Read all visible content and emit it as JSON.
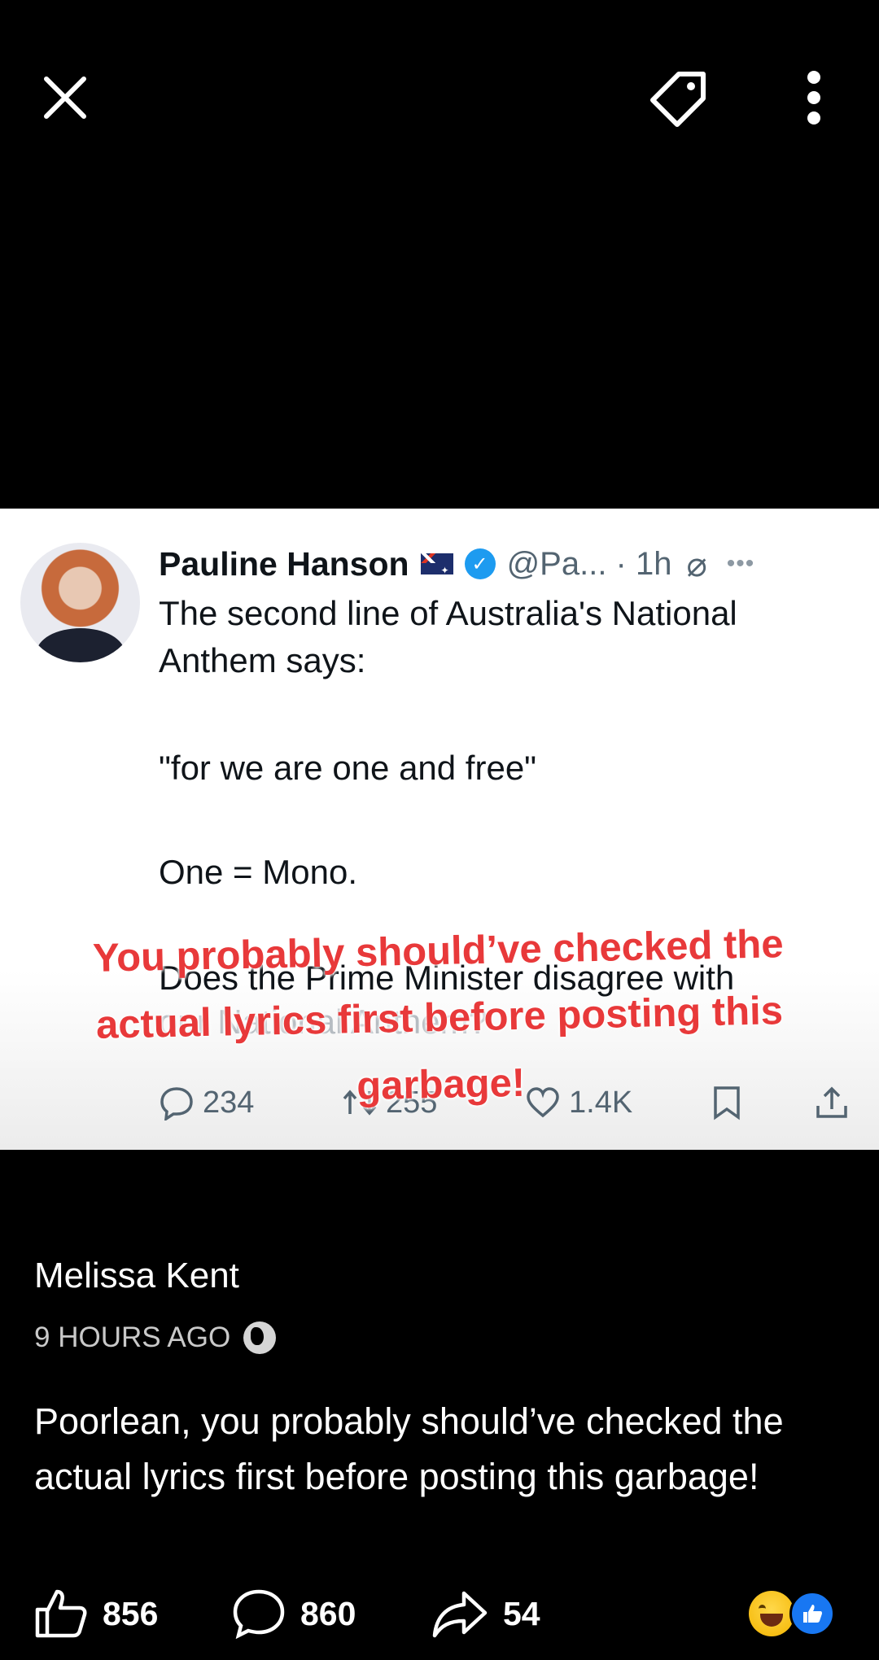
{
  "topbar": {
    "close_icon": "close-icon",
    "tag_icon": "tag-icon",
    "more_icon": "more-vertical-icon"
  },
  "tweet": {
    "author_name": "Pauline Hanson",
    "handle": "@Pa... · 1h",
    "lines": [
      "The second line of Australia's National",
      "Anthem says:",
      "\"for we are one and free\"",
      "One = Mono.",
      "Does the Prime Minister disagree with",
      "our National Anthem?"
    ],
    "replies": "234",
    "retweets": "255",
    "likes": "1.4K",
    "colors": {
      "verified": "#1d9bf0",
      "text": "#0f1419",
      "muted": "#536471"
    }
  },
  "overlay_caption": "You probably should’ve checked the actual lyrics first before posting this garbage!",
  "post": {
    "author": "Melissa Kent",
    "time": "9 HOURS AGO",
    "body": "Poorlean,  you probably should’ve checked the actual lyrics first before posting this garbage!",
    "likes": "856",
    "comments": "860",
    "shares": "54",
    "reactions": [
      "laughing-emoji",
      "like-emoji"
    ],
    "colors": {
      "overlay_red": "#e8393a",
      "like_blue": "#1877f2"
    }
  }
}
